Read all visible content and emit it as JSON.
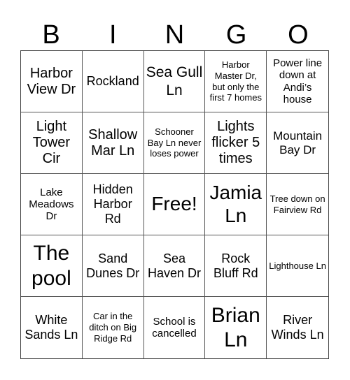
{
  "header": [
    "B",
    "I",
    "N",
    "G",
    "O"
  ],
  "cells": [
    {
      "text": "Harbor View Dr",
      "size": "s20"
    },
    {
      "text": "Rockland",
      "size": "s18"
    },
    {
      "text": "Sea Gull Ln",
      "size": "s21"
    },
    {
      "text": "Harbor Master Dr, but only the first 7 homes",
      "size": "s13"
    },
    {
      "text": "Power line down at Andi’s house",
      "size": "s15"
    },
    {
      "text": "Light Tower Cir",
      "size": "s20"
    },
    {
      "text": "Shallow Mar Ln",
      "size": "s20"
    },
    {
      "text": "Schooner Bay Ln never loses power",
      "size": "s13"
    },
    {
      "text": "Lights flicker 5 times",
      "size": "s20"
    },
    {
      "text": "Mountain Bay Dr",
      "size": "s17"
    },
    {
      "text": "Lake Meadows Dr",
      "size": "s15"
    },
    {
      "text": "Hidden Harbor Rd",
      "size": "s18"
    },
    {
      "text": "Free!",
      "size": "s26"
    },
    {
      "text": "Jamia Ln",
      "size": "s26"
    },
    {
      "text": "Tree down on Fairview Rd",
      "size": "s13"
    },
    {
      "text": "The pool",
      "size": "s30"
    },
    {
      "text": "Sand Dunes Dr",
      "size": "s18"
    },
    {
      "text": "Sea Haven Dr",
      "size": "s18"
    },
    {
      "text": "Rock Bluff Rd",
      "size": "s18"
    },
    {
      "text": "Lighthouse Ln",
      "size": "s13"
    },
    {
      "text": "White Sands Ln",
      "size": "s18"
    },
    {
      "text": "Car in the ditch on Big Ridge Rd",
      "size": "s13"
    },
    {
      "text": "School is cancelled",
      "size": "s15"
    },
    {
      "text": "Brian Ln",
      "size": "s30"
    },
    {
      "text": "River Winds Ln",
      "size": "s18"
    }
  ]
}
